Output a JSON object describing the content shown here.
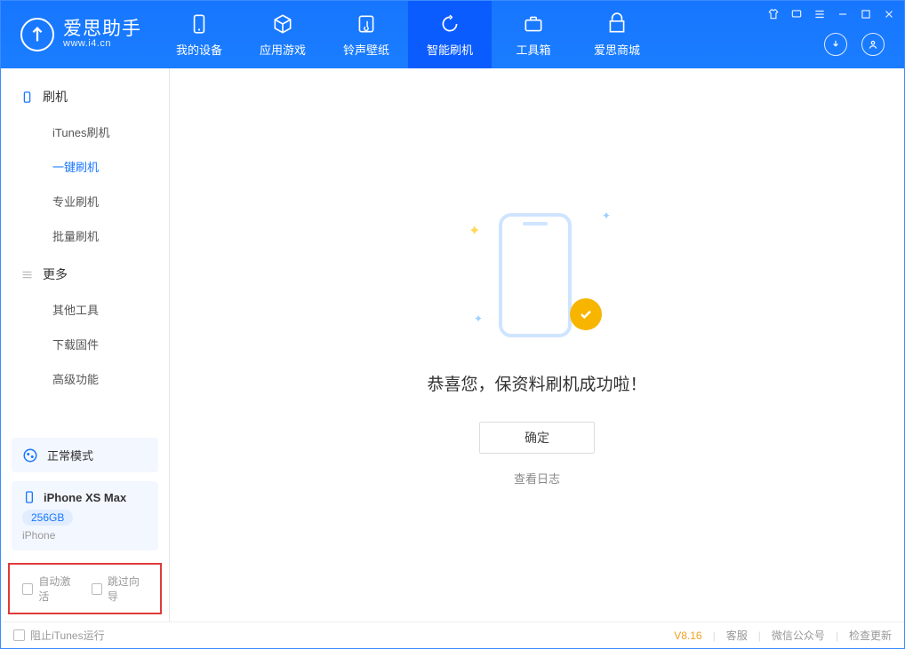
{
  "app": {
    "name": "爱思助手",
    "url": "www.i4.cn"
  },
  "nav": {
    "tabs": [
      {
        "label": "我的设备",
        "icon": "device"
      },
      {
        "label": "应用游戏",
        "icon": "cube"
      },
      {
        "label": "铃声壁纸",
        "icon": "music"
      },
      {
        "label": "智能刷机",
        "icon": "refresh",
        "active": true
      },
      {
        "label": "工具箱",
        "icon": "briefcase"
      },
      {
        "label": "爱思商城",
        "icon": "store"
      }
    ]
  },
  "sidebar": {
    "section1": {
      "title": "刷机",
      "items": [
        {
          "label": "iTunes刷机"
        },
        {
          "label": "一键刷机",
          "active": true
        },
        {
          "label": "专业刷机"
        },
        {
          "label": "批量刷机"
        }
      ]
    },
    "section2": {
      "title": "更多",
      "items": [
        {
          "label": "其他工具"
        },
        {
          "label": "下载固件"
        },
        {
          "label": "高级功能"
        }
      ]
    },
    "mode_label": "正常模式",
    "device": {
      "name": "iPhone XS Max",
      "storage": "256GB",
      "type": "iPhone"
    },
    "checkboxes": {
      "auto_activate": "自动激活",
      "skip_wizard": "跳过向导"
    }
  },
  "content": {
    "message": "恭喜您，保资料刷机成功啦！",
    "ok_label": "确定",
    "view_log": "查看日志"
  },
  "footer": {
    "block_itunes": "阻止iTunes运行",
    "version": "V8.16",
    "support": "客服",
    "wechat": "微信公众号",
    "update": "检查更新"
  }
}
